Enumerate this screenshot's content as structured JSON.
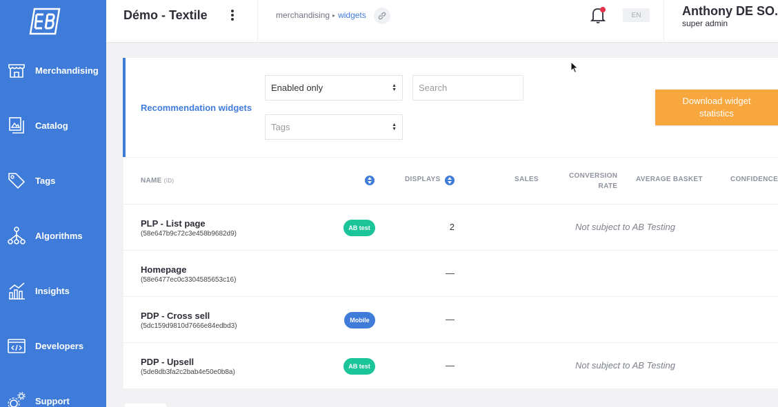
{
  "header": {
    "app_title": "Démo - Textile",
    "breadcrumb": {
      "parent": "merchandising",
      "current": "widgets"
    },
    "language": "EN",
    "user": {
      "name": "Anthony DE SO...",
      "role": "super admin"
    }
  },
  "sidebar": {
    "items": [
      {
        "label": "Merchandising",
        "icon": "storefront-icon"
      },
      {
        "label": "Catalog",
        "icon": "catalog-icon"
      },
      {
        "label": "Tags",
        "icon": "tag-icon"
      },
      {
        "label": "Algorithms",
        "icon": "algorithm-icon"
      },
      {
        "label": "Insights",
        "icon": "insights-chart-icon"
      },
      {
        "label": "Developers",
        "icon": "code-icon"
      },
      {
        "label": "Support",
        "icon": "support-gears-icon"
      }
    ]
  },
  "filters": {
    "section_title": "Recommendation widgets",
    "status_select": "Enabled only",
    "search_placeholder": "Search",
    "tags_placeholder": "Tags",
    "download_button": "Download widget statistics"
  },
  "table": {
    "columns": {
      "name": "NAME",
      "name_sub": "(ID)",
      "displays": "DISPLAYS",
      "sales": "SALES",
      "conversion_line1": "CONVERSION",
      "conversion_line2": "RATE",
      "average_basket": "AVERAGE BASKET",
      "confidence": "CONFIDENCE"
    },
    "rows": [
      {
        "name": "PLP - List page",
        "id": "(58e647b9c72c3e458b9682d9)",
        "badge": "AB test",
        "displays": "2",
        "note": "Not subject to AB Testing"
      },
      {
        "name": "Homepage",
        "id": "(58e6477ec0c3304585653c16)",
        "badge": "",
        "displays": "—",
        "note": ""
      },
      {
        "name": "PDP - Cross sell",
        "id": "(5dc159d9810d7666e84edbd3)",
        "badge": "Mobile",
        "displays": "—",
        "note": ""
      },
      {
        "name": "PDP - Upsell",
        "id": "(5de8db3fa2c2bab4e50e0b8a)",
        "badge": "AB test",
        "displays": "—",
        "note": "Not subject to AB Testing"
      }
    ]
  },
  "colors": {
    "brand_blue": "#3f7bd9",
    "ab_test_green": "#1cc49a",
    "download_orange": "#f8a73f",
    "notification_red": "#e8304c"
  }
}
